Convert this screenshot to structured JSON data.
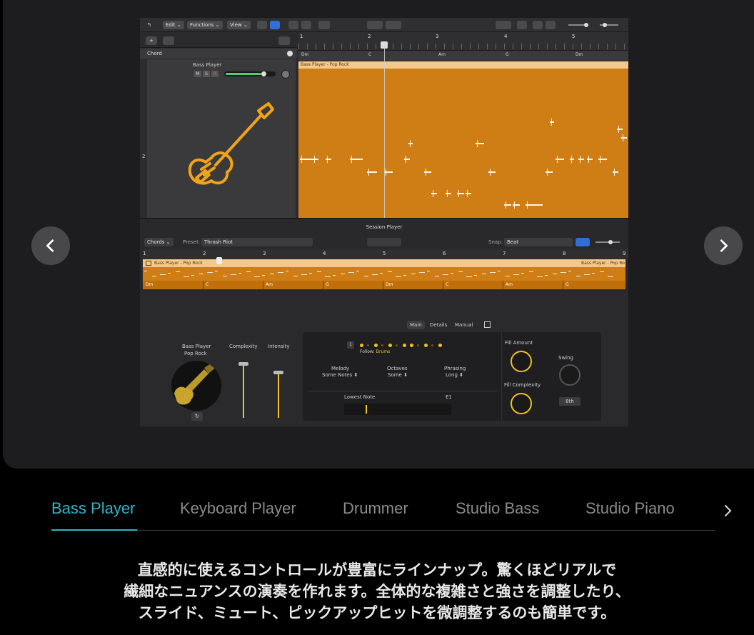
{
  "nav": {
    "prev_icon": "chevron-left-icon",
    "next_icon": "chevron-right-icon"
  },
  "logic": {
    "toolbar": {
      "back": "↰",
      "edit": "Edit ⌄",
      "functions": "Functions ⌄",
      "view": "View ⌄"
    },
    "track": {
      "chord_label": "Chord",
      "bass_player_label": "Bass Player",
      "mute": "M",
      "solo": "S",
      "record": "R",
      "track_number": "2"
    },
    "ruler_numbers": [
      "1",
      "2",
      "3",
      "4",
      "5"
    ],
    "chord_lane": [
      "Dm",
      "C",
      "Am",
      "G",
      "Dm"
    ],
    "region_name": "Bass Player - Pop Rock",
    "session_player_title": "Session Player",
    "session_row": {
      "chords": "Chords ⌄",
      "preset_label": "Preset:",
      "preset_value": "Thrash Riot",
      "snap_label": "Snap:",
      "snap_value": "Beat"
    },
    "sp_ruler_numbers": [
      "1",
      "2",
      "3",
      "4",
      "5",
      "6",
      "7",
      "8",
      "9"
    ],
    "sp_region_left": "Bass Player - Pop Rock",
    "sp_region_right": "Bass Player - Pop Ro",
    "sp_chords": [
      "Dm",
      "C",
      "Am",
      "G",
      "Dm",
      "C",
      "Am",
      "G"
    ],
    "panel": {
      "tabs": [
        "Main",
        "Details",
        "Manual"
      ],
      "player_name": "Bass Player",
      "player_style": "Pop Rock",
      "complexity": "Complexity",
      "intensity": "Intensity",
      "follow_num": "1",
      "follow_label": "Follow:",
      "follow_value": "Drums",
      "melody": "Melody",
      "melody_value": "Some Notes ⬍",
      "octaves": "Octaves",
      "octaves_value": "Some ⬍",
      "phrasing": "Phrasing",
      "phrasing_value": "Long ⬍",
      "lowest_note": "Lowest Note",
      "lowest_note_value": "E1",
      "fill_amount": "Fill Amount",
      "fill_complexity": "Fill Complexity",
      "swing": "Swing",
      "swing_value": "8th"
    }
  },
  "tabs": [
    {
      "label": "Bass Player",
      "active": true
    },
    {
      "label": "Keyboard Player",
      "active": false
    },
    {
      "label": "Drummer",
      "active": false
    },
    {
      "label": "Studio Bass",
      "active": false
    },
    {
      "label": "Studio Piano",
      "active": false
    }
  ],
  "caption": [
    "直感的に使えるコントロールが豊富にラインナップ。驚くほどリアルで",
    "繊細なニュアンスの演奏を作れます。全体的な複雑さと強さを調整したり、",
    "スライド、ミュート、ピックアップヒットを微調整するのも簡単です。"
  ],
  "colors": {
    "accent": "#2cb6c9",
    "region": "#cf7d15",
    "yellow": "#f2c11b"
  }
}
